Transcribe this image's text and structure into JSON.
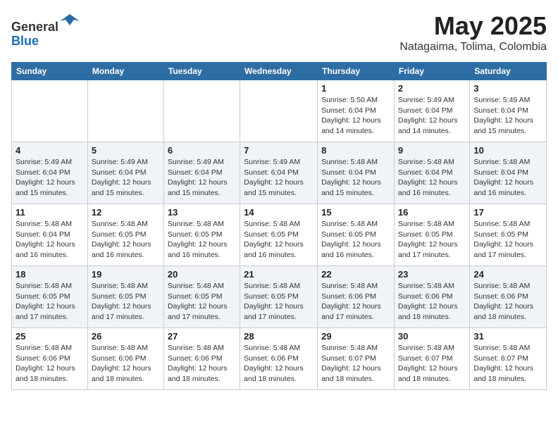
{
  "header": {
    "logo_line1": "General",
    "logo_line2": "Blue",
    "month": "May 2025",
    "location": "Natagaima, Tolima, Colombia"
  },
  "weekdays": [
    "Sunday",
    "Monday",
    "Tuesday",
    "Wednesday",
    "Thursday",
    "Friday",
    "Saturday"
  ],
  "weeks": [
    [
      {
        "day": "",
        "info": ""
      },
      {
        "day": "",
        "info": ""
      },
      {
        "day": "",
        "info": ""
      },
      {
        "day": "",
        "info": ""
      },
      {
        "day": "1",
        "info": "Sunrise: 5:50 AM\nSunset: 6:04 PM\nDaylight: 12 hours\nand 14 minutes."
      },
      {
        "day": "2",
        "info": "Sunrise: 5:49 AM\nSunset: 6:04 PM\nDaylight: 12 hours\nand 14 minutes."
      },
      {
        "day": "3",
        "info": "Sunrise: 5:49 AM\nSunset: 6:04 PM\nDaylight: 12 hours\nand 15 minutes."
      }
    ],
    [
      {
        "day": "4",
        "info": "Sunrise: 5:49 AM\nSunset: 6:04 PM\nDaylight: 12 hours\nand 15 minutes."
      },
      {
        "day": "5",
        "info": "Sunrise: 5:49 AM\nSunset: 6:04 PM\nDaylight: 12 hours\nand 15 minutes."
      },
      {
        "day": "6",
        "info": "Sunrise: 5:49 AM\nSunset: 6:04 PM\nDaylight: 12 hours\nand 15 minutes."
      },
      {
        "day": "7",
        "info": "Sunrise: 5:49 AM\nSunset: 6:04 PM\nDaylight: 12 hours\nand 15 minutes."
      },
      {
        "day": "8",
        "info": "Sunrise: 5:48 AM\nSunset: 6:04 PM\nDaylight: 12 hours\nand 15 minutes."
      },
      {
        "day": "9",
        "info": "Sunrise: 5:48 AM\nSunset: 6:04 PM\nDaylight: 12 hours\nand 16 minutes."
      },
      {
        "day": "10",
        "info": "Sunrise: 5:48 AM\nSunset: 6:04 PM\nDaylight: 12 hours\nand 16 minutes."
      }
    ],
    [
      {
        "day": "11",
        "info": "Sunrise: 5:48 AM\nSunset: 6:04 PM\nDaylight: 12 hours\nand 16 minutes."
      },
      {
        "day": "12",
        "info": "Sunrise: 5:48 AM\nSunset: 6:05 PM\nDaylight: 12 hours\nand 16 minutes."
      },
      {
        "day": "13",
        "info": "Sunrise: 5:48 AM\nSunset: 6:05 PM\nDaylight: 12 hours\nand 16 minutes."
      },
      {
        "day": "14",
        "info": "Sunrise: 5:48 AM\nSunset: 6:05 PM\nDaylight: 12 hours\nand 16 minutes."
      },
      {
        "day": "15",
        "info": "Sunrise: 5:48 AM\nSunset: 6:05 PM\nDaylight: 12 hours\nand 16 minutes."
      },
      {
        "day": "16",
        "info": "Sunrise: 5:48 AM\nSunset: 6:05 PM\nDaylight: 12 hours\nand 17 minutes."
      },
      {
        "day": "17",
        "info": "Sunrise: 5:48 AM\nSunset: 6:05 PM\nDaylight: 12 hours\nand 17 minutes."
      }
    ],
    [
      {
        "day": "18",
        "info": "Sunrise: 5:48 AM\nSunset: 6:05 PM\nDaylight: 12 hours\nand 17 minutes."
      },
      {
        "day": "19",
        "info": "Sunrise: 5:48 AM\nSunset: 6:05 PM\nDaylight: 12 hours\nand 17 minutes."
      },
      {
        "day": "20",
        "info": "Sunrise: 5:48 AM\nSunset: 6:05 PM\nDaylight: 12 hours\nand 17 minutes."
      },
      {
        "day": "21",
        "info": "Sunrise: 5:48 AM\nSunset: 6:05 PM\nDaylight: 12 hours\nand 17 minutes."
      },
      {
        "day": "22",
        "info": "Sunrise: 5:48 AM\nSunset: 6:06 PM\nDaylight: 12 hours\nand 17 minutes."
      },
      {
        "day": "23",
        "info": "Sunrise: 5:48 AM\nSunset: 6:06 PM\nDaylight: 12 hours\nand 18 minutes."
      },
      {
        "day": "24",
        "info": "Sunrise: 5:48 AM\nSunset: 6:06 PM\nDaylight: 12 hours\nand 18 minutes."
      }
    ],
    [
      {
        "day": "25",
        "info": "Sunrise: 5:48 AM\nSunset: 6:06 PM\nDaylight: 12 hours\nand 18 minutes."
      },
      {
        "day": "26",
        "info": "Sunrise: 5:48 AM\nSunset: 6:06 PM\nDaylight: 12 hours\nand 18 minutes."
      },
      {
        "day": "27",
        "info": "Sunrise: 5:48 AM\nSunset: 6:06 PM\nDaylight: 12 hours\nand 18 minutes."
      },
      {
        "day": "28",
        "info": "Sunrise: 5:48 AM\nSunset: 6:06 PM\nDaylight: 12 hours\nand 18 minutes."
      },
      {
        "day": "29",
        "info": "Sunrise: 5:48 AM\nSunset: 6:07 PM\nDaylight: 12 hours\nand 18 minutes."
      },
      {
        "day": "30",
        "info": "Sunrise: 5:48 AM\nSunset: 6:07 PM\nDaylight: 12 hours\nand 18 minutes."
      },
      {
        "day": "31",
        "info": "Sunrise: 5:48 AM\nSunset: 6:07 PM\nDaylight: 12 hours\nand 18 minutes."
      }
    ]
  ]
}
